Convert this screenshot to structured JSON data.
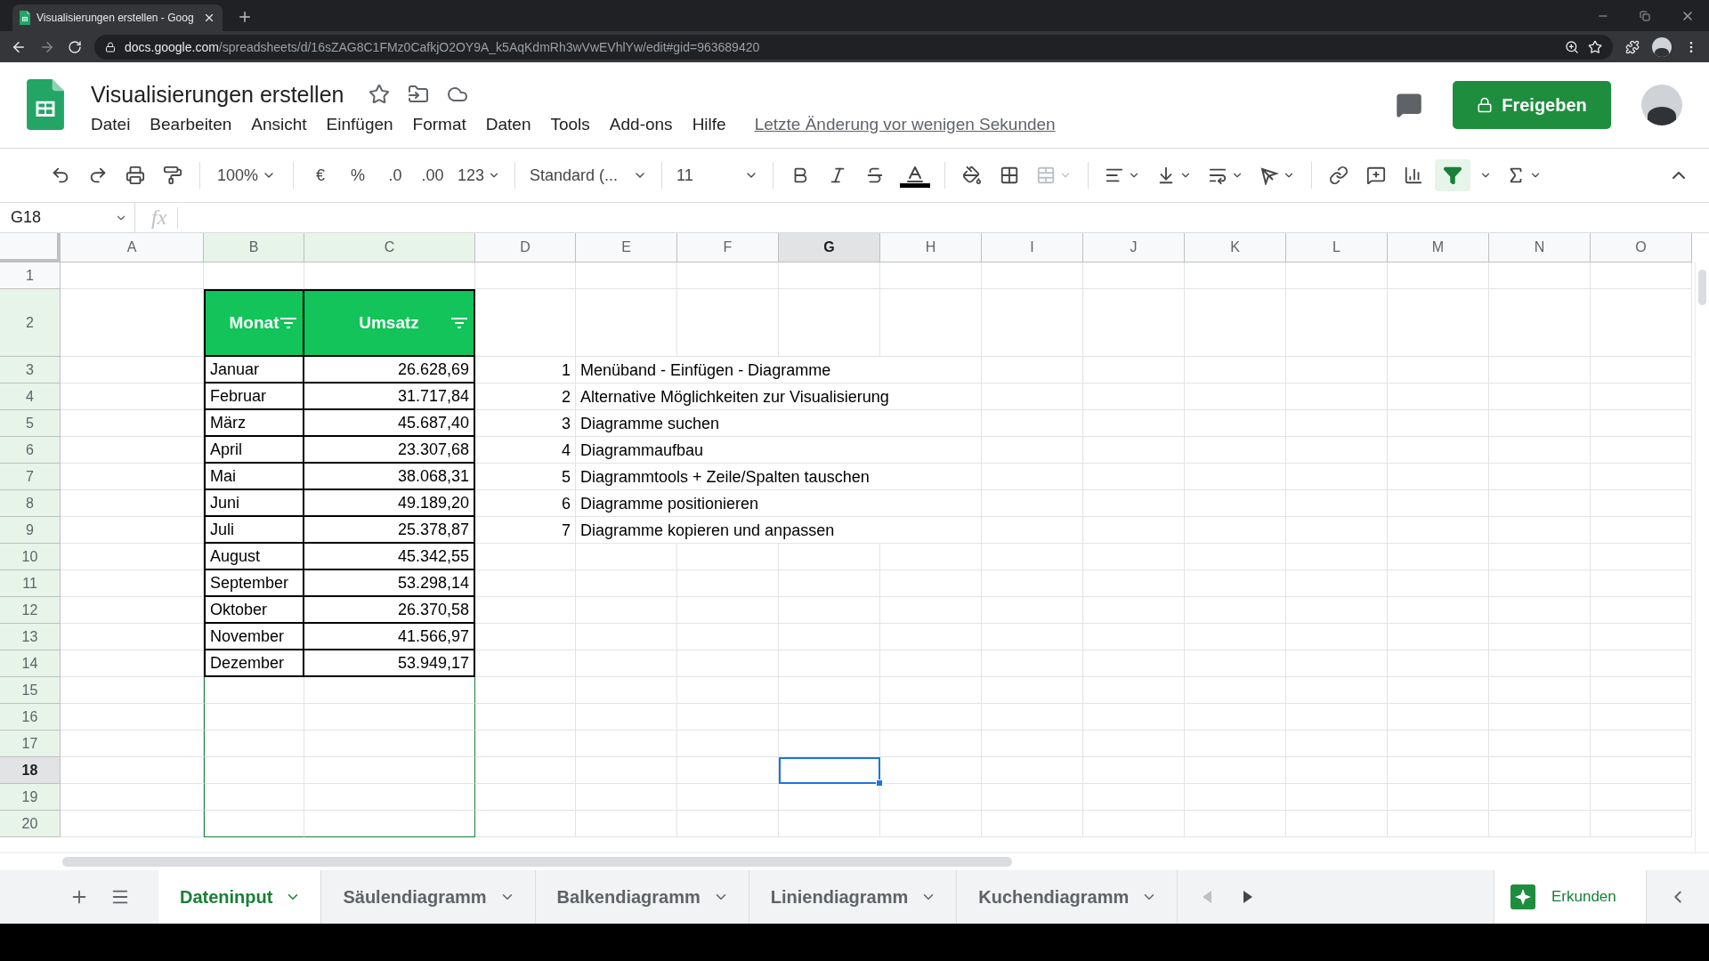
{
  "browser": {
    "tab_title": "Visualisierungen erstellen - Goog",
    "url_domain": "docs.google.com",
    "url_path": "/spreadsheets/d/16sZAG8C1FMz0CafkjO2OY9A_k5AqKdmRh3wVwEVhlYw/edit#gid=963689420"
  },
  "document": {
    "title": "Visualisierungen erstellen",
    "last_edit": "Letzte Änderung vor wenigen Sekunden",
    "share_button": "Freigeben"
  },
  "menu": [
    "Datei",
    "Bearbeiten",
    "Ansicht",
    "Einfügen",
    "Format",
    "Daten",
    "Tools",
    "Add-ons",
    "Hilfe"
  ],
  "toolbar": {
    "zoom": "100%",
    "currency": "€",
    "percent": "%",
    "decrease_decimals": ".0",
    "increase_decimals": ".00",
    "number_format": "123",
    "font": "Standard (...",
    "font_size": "11",
    "filter_active": true
  },
  "formula_bar": {
    "name_box": "G18",
    "fx": "fx"
  },
  "columns": [
    {
      "label": "A",
      "selected": false,
      "in_filter": false
    },
    {
      "label": "B",
      "selected": false,
      "in_filter": true
    },
    {
      "label": "C",
      "selected": false,
      "in_filter": true
    },
    {
      "label": "D",
      "selected": false,
      "in_filter": false
    },
    {
      "label": "E",
      "selected": false,
      "in_filter": false
    },
    {
      "label": "F",
      "selected": false,
      "in_filter": false
    },
    {
      "label": "G",
      "selected": true,
      "in_filter": false
    },
    {
      "label": "H",
      "selected": false,
      "in_filter": false
    },
    {
      "label": "I",
      "selected": false,
      "in_filter": false
    },
    {
      "label": "J",
      "selected": false,
      "in_filter": false
    },
    {
      "label": "K",
      "selected": false,
      "in_filter": false
    },
    {
      "label": "L",
      "selected": false,
      "in_filter": false
    },
    {
      "label": "M",
      "selected": false,
      "in_filter": false
    },
    {
      "label": "N",
      "selected": false,
      "in_filter": false
    },
    {
      "label": "O",
      "selected": false,
      "in_filter": false
    }
  ],
  "row_headers": [
    {
      "label": "1",
      "selected": false,
      "in_filter": false
    },
    {
      "label": "2",
      "selected": false,
      "in_filter": true
    },
    {
      "label": "3",
      "selected": false,
      "in_filter": true
    },
    {
      "label": "4",
      "selected": false,
      "in_filter": true
    },
    {
      "label": "5",
      "selected": false,
      "in_filter": true
    },
    {
      "label": "6",
      "selected": false,
      "in_filter": true
    },
    {
      "label": "7",
      "selected": false,
      "in_filter": true
    },
    {
      "label": "8",
      "selected": false,
      "in_filter": true
    },
    {
      "label": "9",
      "selected": false,
      "in_filter": true
    },
    {
      "label": "10",
      "selected": false,
      "in_filter": true
    },
    {
      "label": "11",
      "selected": false,
      "in_filter": true
    },
    {
      "label": "12",
      "selected": false,
      "in_filter": true
    },
    {
      "label": "13",
      "selected": false,
      "in_filter": true
    },
    {
      "label": "14",
      "selected": false,
      "in_filter": true
    },
    {
      "label": "15",
      "selected": false,
      "in_filter": true
    },
    {
      "label": "16",
      "selected": false,
      "in_filter": true
    },
    {
      "label": "17",
      "selected": false,
      "in_filter": true
    },
    {
      "label": "18",
      "selected": true,
      "in_filter": true
    },
    {
      "label": "19",
      "selected": false,
      "in_filter": true
    },
    {
      "label": "20",
      "selected": false,
      "in_filter": true
    }
  ],
  "table": {
    "header": [
      {
        "label": "Monat",
        "filter": true
      },
      {
        "label": "Umsatz",
        "filter": true
      }
    ],
    "rows": [
      {
        "month": "Januar",
        "revenue": "26.628,69"
      },
      {
        "month": "Februar",
        "revenue": "31.717,84"
      },
      {
        "month": "März",
        "revenue": "45.687,40"
      },
      {
        "month": "April",
        "revenue": "23.307,68"
      },
      {
        "month": "Mai",
        "revenue": "38.068,31"
      },
      {
        "month": "Juni",
        "revenue": "49.189,20"
      },
      {
        "month": "Juli",
        "revenue": "25.378,87"
      },
      {
        "month": "August",
        "revenue": "45.342,55"
      },
      {
        "month": "September",
        "revenue": "53.298,14"
      },
      {
        "month": "Oktober",
        "revenue": "26.370,58"
      },
      {
        "month": "November",
        "revenue": "41.566,97"
      },
      {
        "month": "Dezember",
        "revenue": "53.949,17"
      }
    ]
  },
  "steps": [
    {
      "number": "1",
      "text": "Menüband - Einfügen - Diagramme"
    },
    {
      "number": "2",
      "text": "Alternative Möglichkeiten zur Visualisierung"
    },
    {
      "number": "3",
      "text": "Diagramme suchen"
    },
    {
      "number": "4",
      "text": "Diagrammaufbau"
    },
    {
      "number": "5",
      "text": "Diagrammtools + Zeile/Spalten tauschen"
    },
    {
      "number": "6",
      "text": "Diagramme positionieren"
    },
    {
      "number": "7",
      "text": "Diagramme kopieren und anpassen"
    }
  ],
  "sheet_tabs": [
    {
      "label": "Dateninput",
      "selected": true
    },
    {
      "label": "Säulendiagramm",
      "selected": false
    },
    {
      "label": "Balkendiagramm",
      "selected": false
    },
    {
      "label": "Liniendiagramm",
      "selected": false
    },
    {
      "label": "Kuchendiagramm",
      "selected": false
    }
  ],
  "explore_button": "Erkunden"
}
